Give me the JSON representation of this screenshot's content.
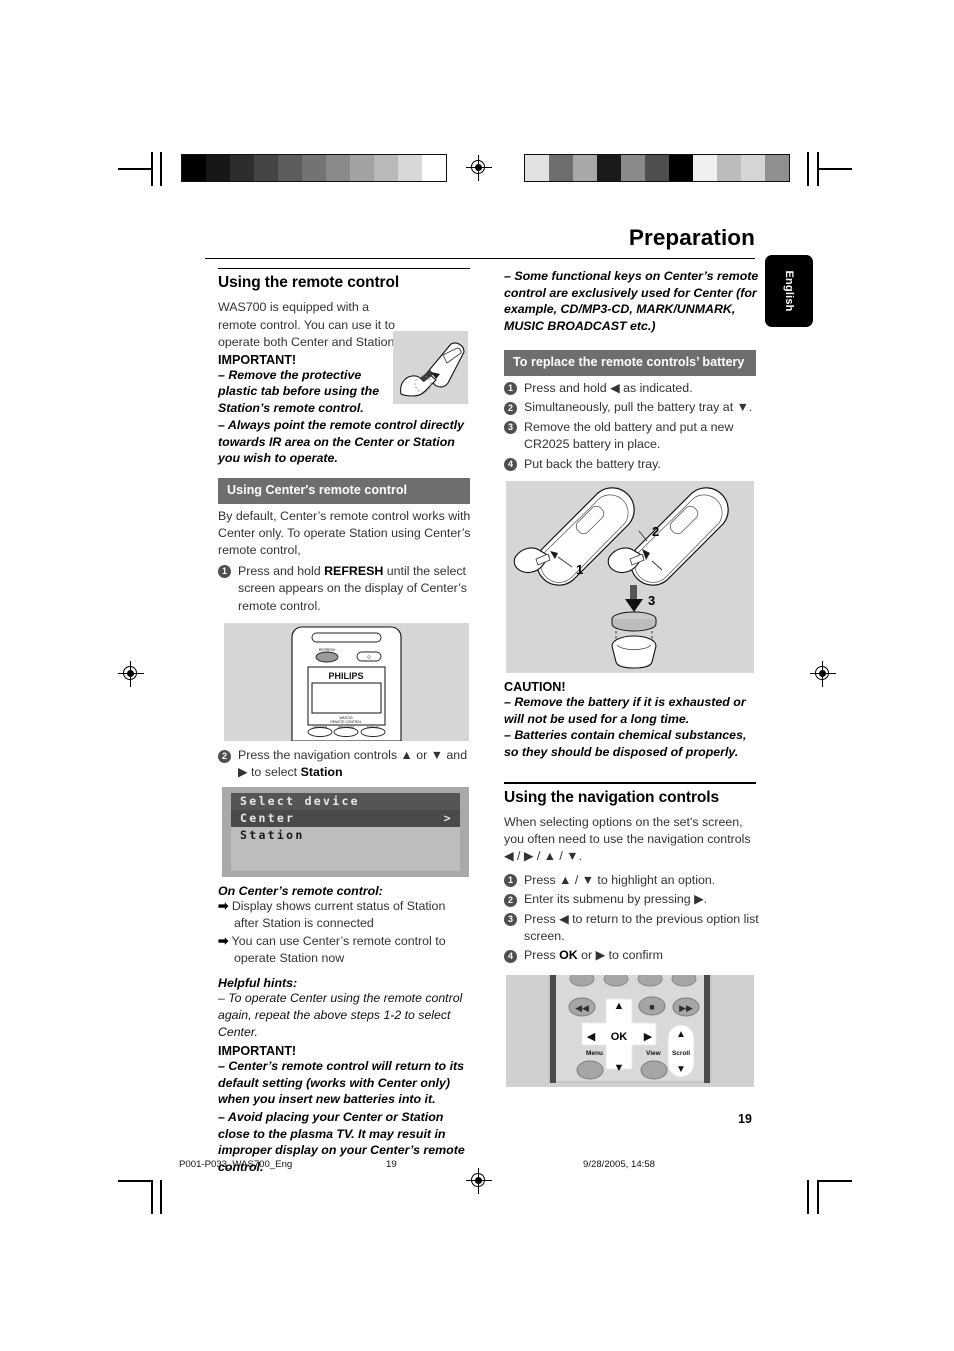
{
  "header": {
    "chapter_title": "Preparation",
    "language_tab": "English"
  },
  "left_column": {
    "section_title": "Using the remote control",
    "intro": "WAS700 is equipped with a remote control. You can use it to operate both Center and Station.",
    "important_label": "IMPORTANT!",
    "important_items": [
      "–  Remove the protective plastic tab before using the Station’s remote control.",
      "–  Always point the remote control directly towards IR area on the Center or Station you wish to operate."
    ],
    "center_remote_bar": "Using Center's remote control",
    "center_remote_intro": "By default, Center’s remote control works with Center only. To operate Station using Center’s remote control,",
    "steps": [
      "Press and hold REFRESH until the select screen appears on the display of  Center’s remote control.",
      "Press the navigation controls ▲ or ▼ and ▶ to select Station"
    ],
    "step1_parts": {
      "a": "Press and hold ",
      "b": "REFRESH",
      "c": " until the select screen appears on the display of  Center’s remote control."
    },
    "step2_parts": {
      "a": "Press the navigation controls ▲  or  ▼  and ▶ to select ",
      "b": "Station"
    },
    "on_center_label": "On Center’s remote control:",
    "arrow_items": [
      "Display shows current status of Station after Station is connected",
      "You can use Center’s remote control to operate Station now"
    ],
    "hints_label": "Helpful hints:",
    "hints_text": "–  To operate Center using the remote control again, repeat the above steps 1-2 to select Center.",
    "important2_label": "IMPORTANT!",
    "important2_items": [
      "–   Center’s remote control will return to its default setting (works with Center only) when you insert new batteries into it.",
      "–  Avoid placing your Center or Station close to the plasma TV.  It may resuit in improper display on your Center’s remote control."
    ]
  },
  "right_column": {
    "note_text": "–  Some functional keys on Center’s remote control are exclusively used for Center (for example, CD/MP3-CD, MARK/UNMARK, MUSIC BROADCAST etc.)",
    "battery_bar": "To replace the remote controls’ battery",
    "battery_steps": [
      "Press and hold ◀ as indicated.",
      "Simultaneously, pull the battery tray at  ▼.",
      "Remove the old battery and put a new CR2025 battery in place.",
      "Put back the battery tray."
    ],
    "caution_label": "CAUTION!",
    "caution_items": [
      "–  Remove the battery if it is exhausted or will not be used for a long time.",
      "–  Batteries contain chemical substances, so they should be disposed of properly."
    ],
    "nav_section_title": "Using the navigation controls",
    "nav_intro": "When selecting options on the set's screen, you often need to use the navigation controls ◀ / ▶ / ▲ / ▼.",
    "nav_steps": [
      "Press  ▲ / ▼ to highlight an option.",
      "Enter its submenu by pressing ▶.",
      "Press ◀ to return to the previous option list screen.",
      "Press OK or ▶ to confirm"
    ],
    "nav_step4_parts": {
      "a": "Press ",
      "b": "OK",
      "c": " or ▶ to confirm"
    }
  },
  "figures": {
    "hand_tab": "remote-plastic-tab-illustration",
    "remote_display": {
      "brand": "PHILIPS",
      "sub_label": "REMOTE CONTROL",
      "button_labels": [
        "REFRESH",
        "UPGRADE",
        "PROGRAM",
        "DISPLAY"
      ]
    },
    "lcd_screen": {
      "title": "Select device",
      "items": [
        {
          "label": "Center",
          "selected": true,
          "chevron": ">"
        },
        {
          "label": "Station",
          "selected": false,
          "chevron": ""
        }
      ]
    },
    "battery_diagram": {
      "callouts": [
        "1",
        "2",
        "3"
      ]
    },
    "nav_remote": {
      "ok_label": "OK",
      "menu_label": "Menu",
      "view_label": "View",
      "scroll_label": "Scroll",
      "arrows": [
        "▲",
        "▼",
        "◀",
        "▶"
      ],
      "transport": [
        "◀◀",
        "■",
        "▶▶"
      ]
    }
  },
  "footer": {
    "file_name": "P001-P033_WAS700_Eng",
    "page_center": "19",
    "timestamp": "9/28/2005, 14:58",
    "page_number": "19"
  },
  "colors": {
    "gray_bar": "#6e6e6e",
    "figure_bg": "#d6d6d6",
    "bullet": "#4f4f4f"
  },
  "grayscale_strip_left": [
    "#000000",
    "#171717",
    "#2d2d2d",
    "#454545",
    "#5c5c5c",
    "#737373",
    "#8a8a8a",
    "#a2a2a2",
    "#b9b9b9",
    "#d8d8d8",
    "#ffffff"
  ],
  "grayscale_strip_right": [
    "#e2e2e2",
    "#6e6e6e",
    "#a8a8a8",
    "#1a1a1a",
    "#8a8a8a",
    "#4f4f4f",
    "#000000",
    "#f0f0f0",
    "#bbbbbb",
    "#d5d5d5",
    "#8f8f8f"
  ]
}
